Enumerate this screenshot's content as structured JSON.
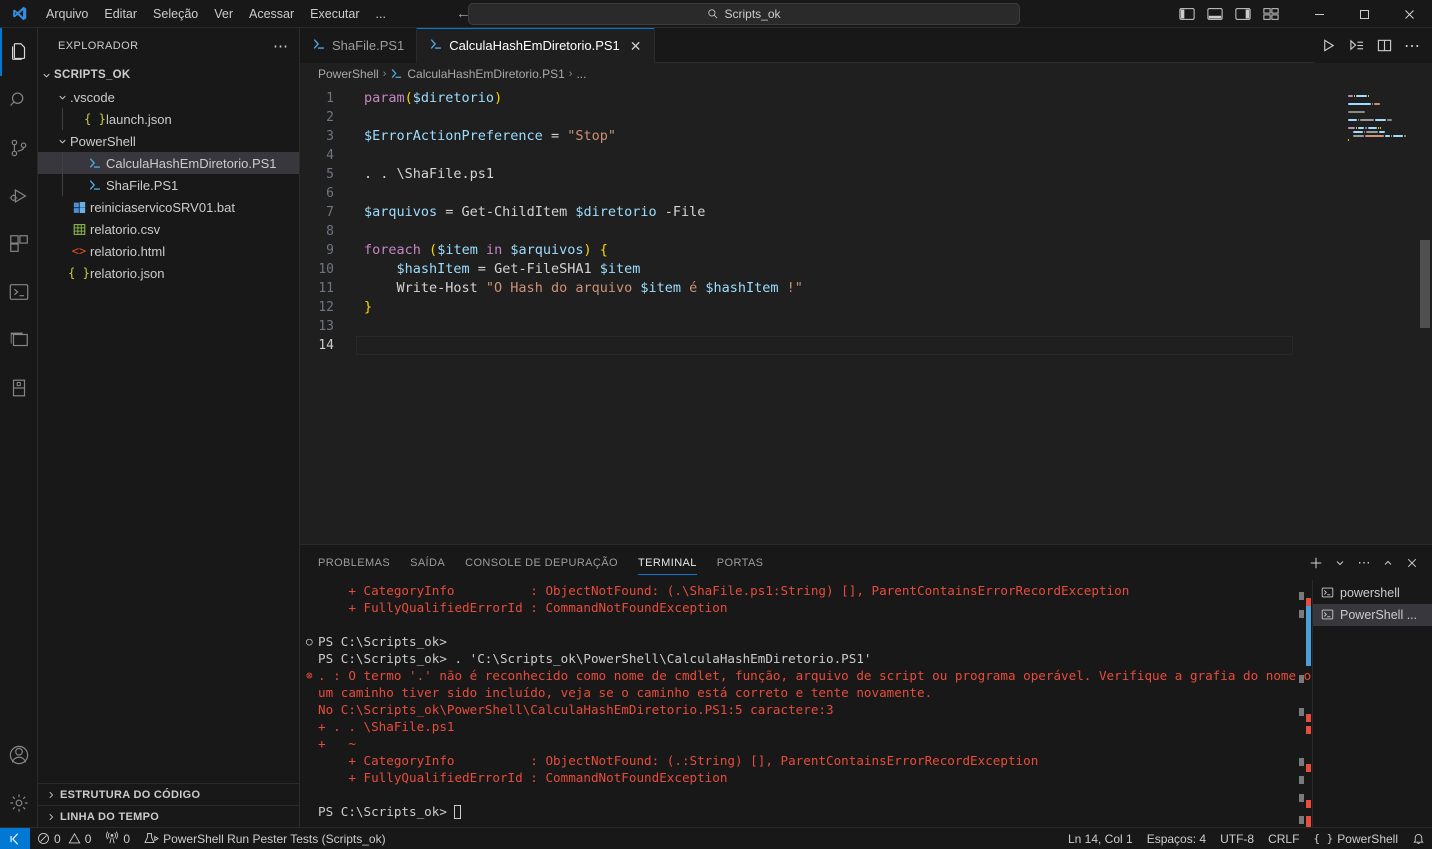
{
  "titlebar": {
    "menu": [
      "Arquivo",
      "Editar",
      "Seleção",
      "Ver",
      "Acessar",
      "Executar",
      "..."
    ],
    "back_icon": "arrow-left-icon",
    "forward_icon": "arrow-right-icon",
    "search_placeholder": "Scripts_ok",
    "search_value": "Scripts_ok",
    "window_minimize": "–",
    "window_maximize": "▢",
    "window_close": "✕"
  },
  "activitybar": {
    "items": [
      {
        "name": "explorer",
        "icon": "files-icon",
        "active": true
      },
      {
        "name": "search",
        "icon": "search-icon",
        "active": false
      },
      {
        "name": "source-control",
        "icon": "source-control-icon",
        "active": false
      },
      {
        "name": "run-and-debug",
        "icon": "run-debug-icon",
        "active": false
      },
      {
        "name": "extensions",
        "icon": "extensions-icon",
        "active": false
      },
      {
        "name": "powershell",
        "icon": "terminal-powershell-icon",
        "active": false
      },
      {
        "name": "remote-explorer",
        "icon": "remote-window-icon",
        "active": false
      },
      {
        "name": "database",
        "icon": "database-icon",
        "active": false
      }
    ],
    "bottom": [
      {
        "name": "accounts",
        "icon": "account-icon"
      },
      {
        "name": "manage",
        "icon": "gear-icon"
      }
    ]
  },
  "sidebar": {
    "title": "EXPLORADOR",
    "more_icon": "ellipsis-icon",
    "tree": [
      {
        "label": "SCRIPTS_OK",
        "indent": 0,
        "type": "folder-root",
        "expanded": true,
        "icon": "chevron-down-icon"
      },
      {
        "label": ".vscode",
        "indent": 1,
        "type": "folder",
        "expanded": true,
        "icon": "chevron-down-icon"
      },
      {
        "label": "launch.json",
        "indent": 2,
        "type": "json",
        "icon": "json-icon"
      },
      {
        "label": "PowerShell",
        "indent": 1,
        "type": "folder",
        "expanded": true,
        "icon": "chevron-down-icon"
      },
      {
        "label": "CalculaHashEmDiretorio.PS1",
        "indent": 2,
        "type": "ps1",
        "icon": "powershell-icon",
        "selected": true
      },
      {
        "label": "ShaFile.PS1",
        "indent": 2,
        "type": "ps1",
        "icon": "powershell-icon"
      },
      {
        "label": "reiniciaservicoSRV01.bat",
        "indent": 1,
        "type": "bat",
        "icon": "windows-icon"
      },
      {
        "label": "relatorio.csv",
        "indent": 1,
        "type": "csv",
        "icon": "spreadsheet-icon"
      },
      {
        "label": "relatorio.html",
        "indent": 1,
        "type": "html",
        "icon": "html-icon"
      },
      {
        "label": "relatorio.json",
        "indent": 1,
        "type": "json",
        "icon": "json-icon"
      }
    ],
    "sections": [
      {
        "label": "ESTRUTURA DO CÓDIGO",
        "icon": "chevron-right-icon"
      },
      {
        "label": "LINHA DO TEMPO",
        "icon": "chevron-right-icon"
      }
    ]
  },
  "editor": {
    "tabs": [
      {
        "label": "ShaFile.PS1",
        "icon": "powershell-icon",
        "active": false,
        "closable": false
      },
      {
        "label": "CalculaHashEmDiretorio.PS1",
        "icon": "powershell-icon",
        "active": true,
        "closable": true,
        "close_icon": "close-icon"
      }
    ],
    "actions": [
      {
        "name": "run-file-button",
        "icon": "play-icon"
      },
      {
        "name": "run-selection-button",
        "icon": "run-selection-icon"
      },
      {
        "name": "split-editor-button",
        "icon": "split-editor-icon"
      },
      {
        "name": "more-actions-button",
        "icon": "ellipsis-icon"
      }
    ],
    "breadcrumb": [
      "PowerShell",
      "CalculaHashEmDiretorio.PS1",
      "..."
    ],
    "code_lines": [
      {
        "n": 1,
        "tokens": [
          [
            "t-kw",
            "param"
          ],
          [
            "t-br1",
            "("
          ],
          [
            "t-var",
            "$diretorio"
          ],
          [
            "t-br1",
            ")"
          ]
        ]
      },
      {
        "n": 2,
        "tokens": []
      },
      {
        "n": 3,
        "tokens": [
          [
            "t-var",
            "$ErrorActionPreference"
          ],
          [
            "t-op",
            " = "
          ],
          [
            "t-str",
            "\"Stop\""
          ]
        ]
      },
      {
        "n": 4,
        "tokens": []
      },
      {
        "n": 5,
        "tokens": [
          [
            "t-plain",
            ". . \\ShaFile.ps1"
          ]
        ]
      },
      {
        "n": 6,
        "tokens": []
      },
      {
        "n": 7,
        "tokens": [
          [
            "t-var",
            "$arquivos"
          ],
          [
            "t-op",
            " = "
          ],
          [
            "t-cmd",
            "Get-ChildItem "
          ],
          [
            "t-var",
            "$diretorio"
          ],
          [
            "t-plain",
            " -File"
          ]
        ]
      },
      {
        "n": 8,
        "tokens": []
      },
      {
        "n": 9,
        "tokens": [
          [
            "t-kw",
            "foreach"
          ],
          [
            "t-plain",
            " "
          ],
          [
            "t-br1",
            "("
          ],
          [
            "t-var",
            "$item"
          ],
          [
            "t-kw",
            " in "
          ],
          [
            "t-var",
            "$arquivos"
          ],
          [
            "t-br1",
            ")"
          ],
          [
            "t-plain",
            " "
          ],
          [
            "t-br1",
            "{"
          ]
        ]
      },
      {
        "n": 10,
        "tokens": [
          [
            "t-plain",
            "    "
          ],
          [
            "t-var",
            "$hashItem"
          ],
          [
            "t-op",
            " = "
          ],
          [
            "t-cmd",
            "Get-FileSHA1 "
          ],
          [
            "t-var",
            "$item"
          ]
        ]
      },
      {
        "n": 11,
        "tokens": [
          [
            "t-plain",
            "    "
          ],
          [
            "t-cmd",
            "Write-Host "
          ],
          [
            "t-str",
            "\"O Hash do arquivo "
          ],
          [
            "t-var",
            "$item"
          ],
          [
            "t-str",
            " é "
          ],
          [
            "t-var",
            "$hashItem"
          ],
          [
            "t-str",
            " !\""
          ]
        ]
      },
      {
        "n": 12,
        "tokens": [
          [
            "t-br1",
            "}"
          ]
        ]
      },
      {
        "n": 13,
        "tokens": []
      },
      {
        "n": 14,
        "tokens": [],
        "current": true
      }
    ]
  },
  "panel": {
    "tabs": [
      {
        "label": "PROBLEMAS",
        "active": false
      },
      {
        "label": "SAÍDA",
        "active": false
      },
      {
        "label": "CONSOLE DE DEPURAÇÃO",
        "active": false
      },
      {
        "label": "TERMINAL",
        "active": true
      },
      {
        "label": "PORTAS",
        "active": false
      }
    ],
    "actions": [
      {
        "name": "new-terminal-button",
        "icon": "plus-icon"
      },
      {
        "name": "terminal-profile-dropdown",
        "icon": "chevron-down-icon"
      },
      {
        "name": "panel-more-actions-button",
        "icon": "ellipsis-icon"
      },
      {
        "name": "maximize-panel-button",
        "icon": "chevron-up-icon"
      },
      {
        "name": "close-panel-button",
        "icon": "close-icon"
      }
    ],
    "terminal_lines": [
      {
        "text": "    + CategoryInfo          : ObjectNotFound: (.\\ShaFile.ps1:String) [], ParentContainsErrorRecordException",
        "type": "err"
      },
      {
        "text": "    + FullyQualifiedErrorId : CommandNotFoundException",
        "type": "err"
      },
      {
        "text": "",
        "type": "out"
      },
      {
        "text": "PS C:\\Scripts_ok>",
        "type": "out",
        "mark": "ok"
      },
      {
        "text": "PS C:\\Scripts_ok> . 'C:\\Scripts_ok\\PowerShell\\CalculaHashEmDiretorio.PS1'",
        "type": "out"
      },
      {
        "text": ". : O termo '.' não é reconhecido como nome de cmdlet, função, arquivo de script ou programa operável. Verifique a grafia do nome ou, se",
        "type": "err",
        "mark": "error"
      },
      {
        "text": "um caminho tiver sido incluído, veja se o caminho está correto e tente novamente.",
        "type": "err"
      },
      {
        "text": "No C:\\Scripts_ok\\PowerShell\\CalculaHashEmDiretorio.PS1:5 caractere:3",
        "type": "err"
      },
      {
        "text": "+ . . \\ShaFile.ps1",
        "type": "err"
      },
      {
        "text": "+   ~",
        "type": "err"
      },
      {
        "text": "    + CategoryInfo          : ObjectNotFound: (.:String) [], ParentContainsErrorRecordException",
        "type": "err"
      },
      {
        "text": "    + FullyQualifiedErrorId : CommandNotFoundException",
        "type": "err"
      },
      {
        "text": "",
        "type": "out"
      },
      {
        "text": "PS C:\\Scripts_ok> ",
        "type": "out",
        "cursor": true
      }
    ],
    "side_list": [
      {
        "label": "powershell",
        "icon": "terminal-icon",
        "active": false
      },
      {
        "label": "PowerShell ...",
        "icon": "terminal-icon",
        "active": true
      }
    ]
  },
  "statusbar": {
    "remote_icon": "remote-indicator-icon",
    "left": [
      {
        "name": "errors-warnings",
        "icon": "error-icon",
        "label": "0",
        "icon2": "warning-icon",
        "label2": "0"
      },
      {
        "name": "ports-forwarded",
        "icon": "radio-tower-icon",
        "label": "0"
      },
      {
        "name": "pester-tests",
        "icon": "beaker-run-icon",
        "label": "PowerShell Run Pester Tests (Scripts_ok)"
      }
    ],
    "right": [
      {
        "name": "cursor-position",
        "label": "Ln 14, Col 1"
      },
      {
        "name": "indentation",
        "label": "Espaços: 4"
      },
      {
        "name": "encoding",
        "label": "UTF-8"
      },
      {
        "name": "eol",
        "label": "CRLF"
      },
      {
        "name": "language-mode",
        "label": "PowerShell",
        "icon": "braces-icon"
      },
      {
        "name": "notifications",
        "icon": "bell-icon"
      }
    ]
  },
  "colors": {
    "accent": "#0078d4",
    "bg": "#1f1f1f",
    "error": "#e74c3c"
  }
}
